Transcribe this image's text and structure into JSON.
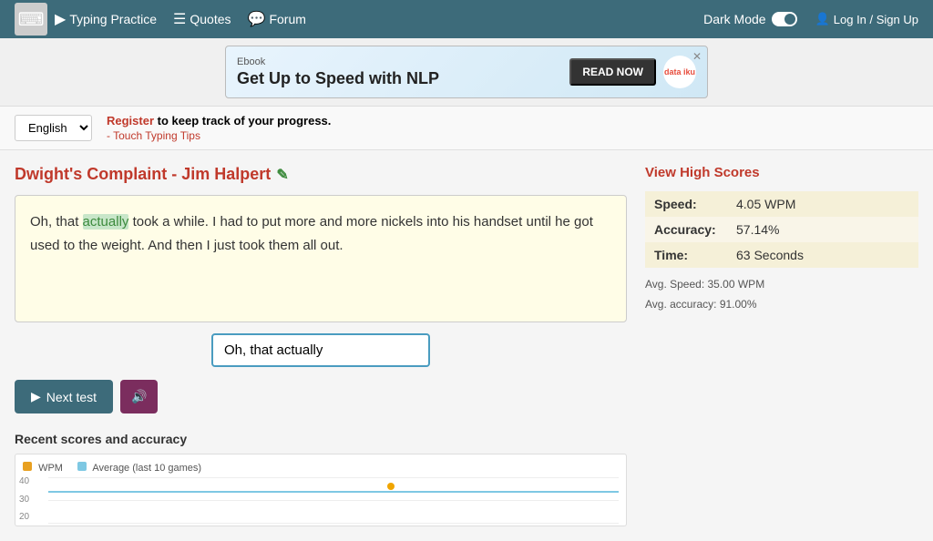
{
  "navbar": {
    "logo_icon": "⌨",
    "typing_practice_label": "Typing Practice",
    "quotes_label": "Quotes",
    "forum_label": "Forum",
    "dark_mode_label": "Dark Mode",
    "login_label": "Log In / Sign Up"
  },
  "banner": {
    "ebook_label": "Ebook",
    "title": "Get Up to Speed with NLP",
    "read_btn_label": "READ NOW",
    "logo_text": "data iku",
    "close_label": "✕"
  },
  "register_bar": {
    "language_value": "English",
    "register_link_text": "Register",
    "register_message": " to keep track of your progress.",
    "touch_typing_link": "Touch Typing Tips"
  },
  "quote": {
    "title": "Dwight's Complaint - Jim Halpert",
    "edit_icon": "✎",
    "text_prefix": "Oh, that ",
    "text_highlight": "actually",
    "text_suffix": " took a while. I had to put more and more nickels into his handset until he got used to the weight. And then I just took them all out.",
    "input_value": "Oh, that actually"
  },
  "buttons": {
    "next_test_label": "Next test",
    "next_icon": "▶",
    "sound_icon": "🔊"
  },
  "recent_scores": {
    "title": "Recent scores and accuracy",
    "legend_wpm": "WPM",
    "legend_avg": "Average (last 10 games)",
    "y_axis": [
      "40",
      "30",
      "20"
    ],
    "score_dot_x": "60%",
    "score_dot_y": "20%"
  },
  "high_scores": {
    "link_label": "View High Scores",
    "speed_label": "Speed:",
    "speed_value": "4.05 WPM",
    "accuracy_label": "Accuracy:",
    "accuracy_value": "57.14%",
    "time_label": "Time:",
    "time_value": "63 Seconds",
    "avg_speed_label": "Avg. Speed: 35.00 WPM",
    "avg_accuracy_label": "Avg. accuracy: 91.00%"
  }
}
